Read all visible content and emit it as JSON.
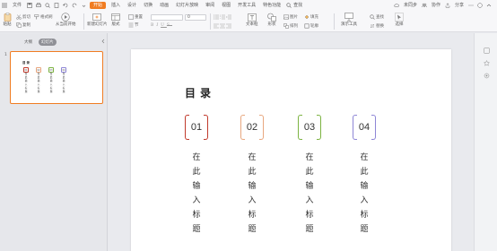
{
  "menubar": {
    "file_label": "文件",
    "tabs": [
      "开始",
      "插入",
      "设计",
      "切换",
      "动画",
      "幻灯片放映",
      "审阅",
      "视图",
      "开发工具",
      "特色功能"
    ],
    "active_tab": "开始",
    "search_label": "查找",
    "right_items": [
      "未同步",
      "协作",
      "分享"
    ]
  },
  "ribbon": {
    "paste": "粘贴",
    "cut": "剪切",
    "copy": "复制",
    "format_painter": "格式刷",
    "play_from_current": "从当前开始",
    "new_slide": "新建幻灯片",
    "layout": "版式",
    "reset": "重置",
    "section": "节",
    "font_name": "",
    "font_size": "0",
    "text_box": "文本框",
    "shape": "形状",
    "arrange": "排列",
    "picture": "图片",
    "fill": "填充",
    "outline": "轮廓",
    "presentation_tools": "演示工具",
    "find": "查找",
    "replace": "替换",
    "select": "选择"
  },
  "left_panel": {
    "tab_outline": "大纲",
    "tab_slides": "幻灯片",
    "slide_number": "1"
  },
  "slide": {
    "title": "目录",
    "items": [
      {
        "number": "01",
        "chars": [
          "在",
          "此",
          "输",
          "入",
          "标",
          "题"
        ],
        "color": "#c0392b"
      },
      {
        "number": "02",
        "chars": [
          "在",
          "此",
          "输",
          "入",
          "标",
          "题"
        ],
        "color": "#e8a77f"
      },
      {
        "number": "03",
        "chars": [
          "在",
          "此",
          "输",
          "入",
          "标",
          "题"
        ],
        "color": "#7cb342"
      },
      {
        "number": "04",
        "chars": [
          "在",
          "此",
          "输",
          "入",
          "标",
          "题"
        ],
        "color": "#8e86d6"
      }
    ]
  },
  "colors": {
    "accent": "#f07c22"
  }
}
